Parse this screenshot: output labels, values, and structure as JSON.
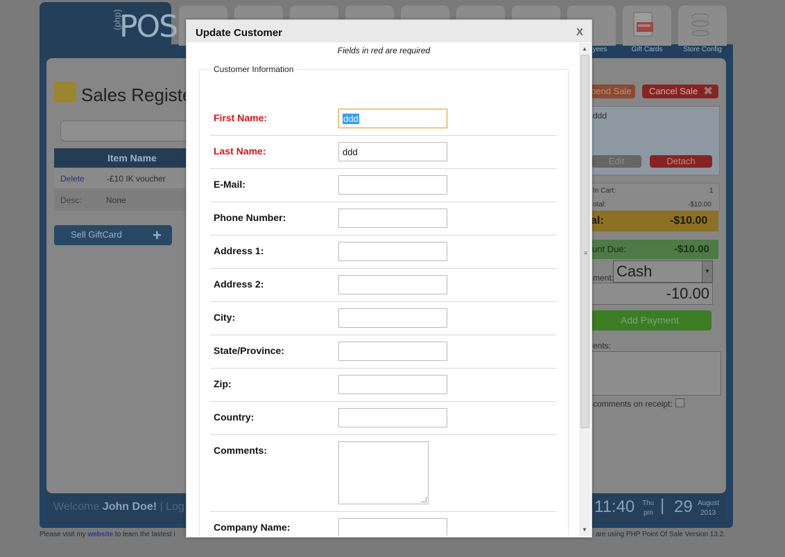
{
  "app": {
    "logo_text": "POS",
    "logo_php": "(php)",
    "tiles": [
      {
        "label": ""
      },
      {
        "label": ""
      },
      {
        "label": ""
      },
      {
        "label": ""
      },
      {
        "label": ""
      },
      {
        "label": ""
      },
      {
        "label": ""
      },
      {
        "label": "yees"
      },
      {
        "label": "Gift Cards"
      },
      {
        "label": "Store Config"
      }
    ],
    "page_title": "Sales Registe",
    "grid_header": "Item Name",
    "row1": {
      "action": "Delete",
      "item": "-£10 IK voucher"
    },
    "row2": {
      "label": "Desc:",
      "value": "None"
    },
    "sell_giftcard": "Sell GiftCard",
    "sell_giftcard_plus": "+",
    "suspend_sale": "pend Sale",
    "cancel_sale": "Cancel Sale",
    "cancel_icon": "✖",
    "customer_name": "ddd",
    "edit_label": "Edit",
    "detach_label": "Detach",
    "items_in_cart_label": "In Cart:",
    "items_in_cart_value": "1",
    "subtotal_label": "otal:",
    "subtotal_value": "-$10.00",
    "total_label": "al:",
    "total_value": "-$10.00",
    "amount_due_label": "unt Due:",
    "amount_due_value": "-$10.00",
    "payment_type_label": "ment:",
    "payment_type": "Cash",
    "payment_amount": "-10.00",
    "add_payment": "Add Payment",
    "comments_label": "ents:",
    "show_comments_label": "comments on receipt:",
    "welcome_prefix": "Welcome ",
    "welcome_user": "John Doe!",
    "welcome_suffix": " | Log",
    "time": "11:40",
    "day_name": "Thu",
    "ampm": "pm",
    "sep": "|",
    "day": "29",
    "month": "August",
    "year": "2013",
    "footer_left_prefix": "Please visit my ",
    "footer_link": "website",
    "footer_left_suffix": " to learn the lastest i",
    "footer_right": "are using PHP Point Of Sale Version 13.2."
  },
  "modal": {
    "title": "Update Customer",
    "close": "X",
    "required_note": "Fields in red are required",
    "legend": "Customer Information",
    "fields": [
      {
        "label": "First Name:",
        "value": "ddd",
        "required": true
      },
      {
        "label": "Last Name:",
        "value": "ddd",
        "required": true
      },
      {
        "label": "E-Mail:",
        "value": ""
      },
      {
        "label": "Phone Number:",
        "value": ""
      },
      {
        "label": "Address 1:",
        "value": ""
      },
      {
        "label": "Address 2:",
        "value": ""
      },
      {
        "label": "City:",
        "value": ""
      },
      {
        "label": "State/Province:",
        "value": ""
      },
      {
        "label": "Zip:",
        "value": ""
      },
      {
        "label": "Country:",
        "value": ""
      },
      {
        "label": "Comments:",
        "value": ""
      },
      {
        "label": "Company Name:",
        "value": ""
      }
    ]
  },
  "colors": {
    "required_label": "#d0141a",
    "focus_border": "#e8a33a",
    "selection": "#3399ff"
  }
}
